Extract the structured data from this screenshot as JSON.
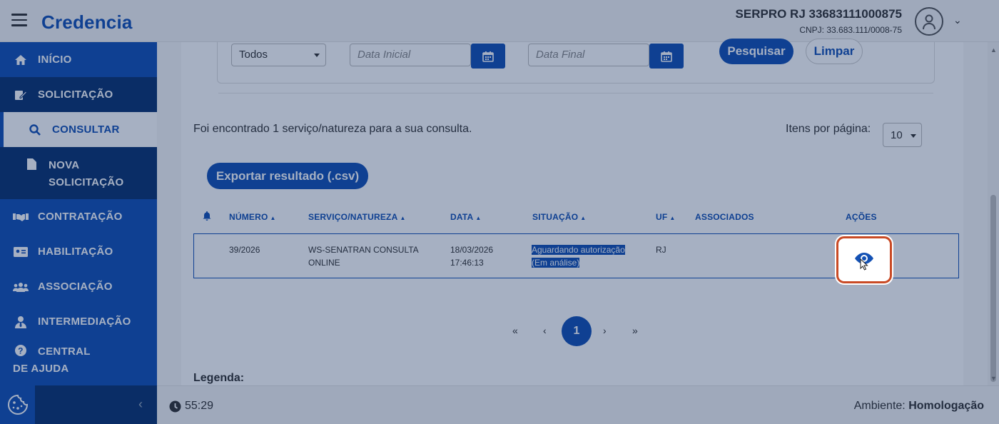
{
  "header": {
    "logo": "Credencia",
    "org_name": "SERPRO RJ 33683111000875",
    "cnpj": "CNPJ: 33.683.111/0008-75"
  },
  "sidebar": {
    "items": [
      {
        "label": "INÍCIO",
        "icon": "home-icon"
      },
      {
        "label": "SOLICITAÇÃO",
        "icon": "edit-document-icon"
      },
      {
        "label": "CONSULTAR",
        "icon": "search-icon"
      },
      {
        "label": "NOVA SOLICITAÇÃO",
        "icon": "file-icon"
      },
      {
        "label": "CONTRATAÇÃO",
        "icon": "handshake-icon"
      },
      {
        "label": "HABILITAÇÃO",
        "icon": "id-card-icon"
      },
      {
        "label": "ASSOCIAÇÃO",
        "icon": "users-icon"
      },
      {
        "label": "INTERMEDIAÇÃO",
        "icon": "user-tie-icon"
      },
      {
        "label": "CENTRAL DE AJUDA",
        "icon": "question-circle-icon"
      }
    ]
  },
  "filters": {
    "status_select": "Todos",
    "date_start_placeholder": "Data Inicial",
    "date_end_placeholder": "Data Final",
    "search_label": "Pesquisar",
    "clear_label": "Limpar"
  },
  "results": {
    "summary": "Foi encontrado 1 serviço/natureza para a sua consulta.",
    "items_per_page_label": "Itens por página:",
    "items_per_page_value": "10",
    "export_label": "Exportar resultado (.csv)"
  },
  "table": {
    "headers": {
      "numero": "NÚMERO",
      "servico": "SERVIÇO/NATUREZA",
      "data": "DATA",
      "situacao": "SITUAÇÃO",
      "uf": "UF",
      "associados": "ASSOCIADOS",
      "acoes": "AÇÕES"
    },
    "rows": [
      {
        "numero": "39/2026",
        "servico_l1": "WS-SENATRAN CONSULTA",
        "servico_l2": "ONLINE",
        "data_l1": "18/03/2026",
        "data_l2": "17:46:13",
        "situacao_l1": "Aguardando autorização",
        "situacao_l2": "(Em análise)",
        "uf": "RJ"
      }
    ]
  },
  "pagination": {
    "first": "«",
    "prev": "‹",
    "current": "1",
    "next": "›",
    "last": "»"
  },
  "legend_label": "Legenda:",
  "footer": {
    "timer": "55:29",
    "env_label": "Ambiente:",
    "env_value": "Homologação"
  },
  "colors": {
    "primary": "#1351b4",
    "dark": "#0c326f",
    "highlight_border": "#c94a25"
  }
}
